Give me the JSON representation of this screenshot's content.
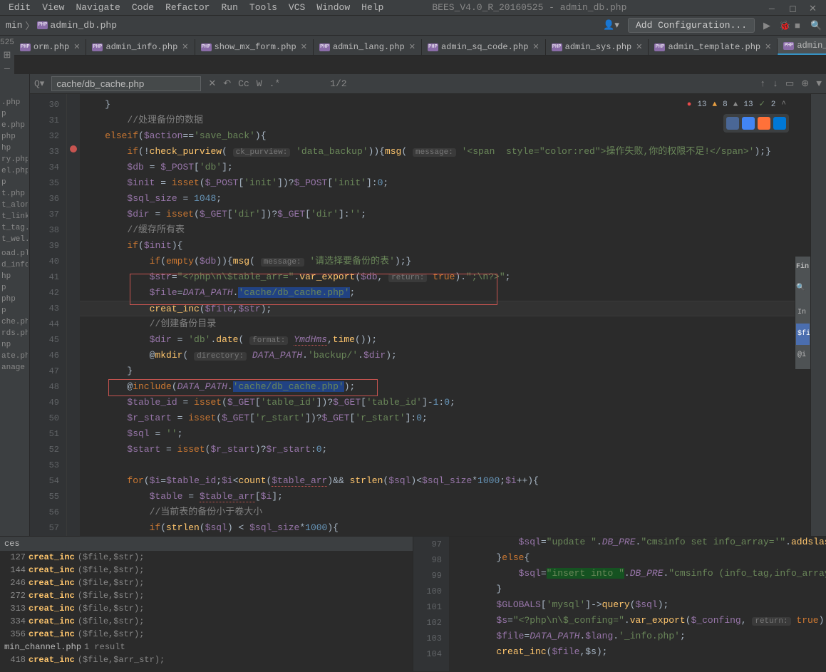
{
  "menu": {
    "edit": "Edit",
    "view": "View",
    "navigate": "Navigate",
    "code": "Code",
    "refactor": "Refactor",
    "run": "Run",
    "tools": "Tools",
    "vcs": "VCS",
    "window": "Window",
    "help": "Help"
  },
  "window_title": "BEES_V4.0_R_20160525 - admin_db.php",
  "breadcrumb": {
    "item1": "min",
    "item2": "admin_db.php"
  },
  "add_config_label": "Add Configuration...",
  "left_gutter": {
    "num": "525"
  },
  "tabs": [
    {
      "label": "orm.php"
    },
    {
      "label": "admin_info.php"
    },
    {
      "label": "show_mx_form.php"
    },
    {
      "label": "admin_lang.php"
    },
    {
      "label": "admin_sq_code.php"
    },
    {
      "label": "admin_sys.php"
    },
    {
      "label": "admin_template.php"
    },
    {
      "label": "admin_db.php",
      "active": true
    }
  ],
  "search": {
    "value": "cache/db_cache.php",
    "count": "1/2",
    "cc": "Cc",
    "w": "W"
  },
  "indicators": {
    "errors": "13",
    "warnings": "8",
    "weak": "13",
    "green": "2"
  },
  "left_tree": [
    ".php",
    "p",
    "e.php",
    "php",
    "hp",
    "ry.php",
    "el.php",
    "p",
    "t.php",
    "t_alone",
    "t_link.p",
    "t_tag.p",
    "t_wel.p",
    "",
    "oad.pl",
    "d_info.",
    "hp",
    "p",
    "php",
    "p",
    "che.ph",
    "rds.php",
    "np",
    "ate.php",
    "anage"
  ],
  "line_numbers": [
    "30",
    "31",
    "32",
    "33",
    "34",
    "35",
    "36",
    "37",
    "38",
    "39",
    "40",
    "41",
    "42",
    "43",
    "44",
    "45",
    "46",
    "47",
    "48",
    "49",
    "50",
    "51",
    "52",
    "53",
    "54",
    "55",
    "56",
    "57"
  ],
  "code": {
    "l30": "    }",
    "l31": "    //处理备份的数据",
    "l32_a": "elseif",
    "l32_b": "(",
    "l32_c": "$action",
    "l32_d": "==",
    "l32_e": "'save_back'",
    "l32_f": "){",
    "l33_a": "if",
    "l33_b": "(!",
    "l33_c": "check_purview",
    "l33_d": "(",
    "l33_hint1": "ck_purview:",
    "l33_e": "'data_backup'",
    "l33_f": ")){",
    "l33_g": "msg",
    "l33_h": "(",
    "l33_hint2": "message:",
    "l33_i": "'<span  style=\"color:red\">操作失败,你的权限不足!</span>'",
    "l33_j": ");}",
    "l34_a": "$db",
    "l34_b": " = ",
    "l34_c": "$_POST",
    "l34_d": "[",
    "l34_e": "'db'",
    "l34_f": "];",
    "l35_a": "$init",
    "l35_b": " = ",
    "l35_c": "isset",
    "l35_d": "(",
    "l35_e": "$_POST",
    "l35_f": "[",
    "l35_g": "'init'",
    "l35_h": "])?",
    "l35_i": "$_POST",
    "l35_j": "[",
    "l35_k": "'init'",
    "l35_l": "]:",
    "l35_m": "0",
    "l35_n": ";",
    "l36_a": "$sql_size",
    "l36_b": " = ",
    "l36_c": "1048",
    "l36_d": ";",
    "l37_a": "$dir",
    "l37_b": " = ",
    "l37_c": "isset",
    "l37_d": "(",
    "l37_e": "$_GET",
    "l37_f": "[",
    "l37_g": "'dir'",
    "l37_h": "])?",
    "l37_i": "$_GET",
    "l37_j": "[",
    "l37_k": "'dir'",
    "l37_l": "]:",
    "l37_m": "''",
    "l37_n": ";",
    "l38": "//缓存所有表",
    "l39_a": "if",
    "l39_b": "(",
    "l39_c": "$init",
    "l39_d": "){",
    "l40_a": "if",
    "l40_b": "(",
    "l40_c": "empty",
    "l40_d": "(",
    "l40_e": "$db",
    "l40_f": ")){",
    "l40_g": "msg",
    "l40_h": "(",
    "l40_hint": "message:",
    "l40_i": "'请选择要备份的表'",
    "l40_j": ");}",
    "l41_a": "$str",
    "l41_b": "=",
    "l41_c": "\"<?php\\n\\$table_arr=\"",
    "l41_d": ".",
    "l41_e": "var_export",
    "l41_f": "(",
    "l41_g": "$db",
    "l41_h": ",",
    "l41_hint": "return:",
    "l41_i": "true",
    "l41_j": ").",
    "l41_k": "\";\\n?>\"",
    "l41_l": ";",
    "l42_a": "$file",
    "l42_b": "=",
    "l42_c": "DATA_PATH",
    "l42_d": ".",
    "l42_e": "'cache/db_cache.php'",
    "l42_f": ";",
    "l43_a": " creat_inc",
    "l43_b": "(",
    "l43_c": "$file",
    "l43_d": ",",
    "l43_e": "$str",
    "l43_f": ");",
    "l44": "//创建备份目录",
    "l45_a": "$dir",
    "l45_b": " = ",
    "l45_c": "'db'",
    "l45_d": ".",
    "l45_e": "date",
    "l45_f": "(",
    "l45_hint": "format:",
    "l45_g": "YmdHms",
    "l45_h": ",",
    "l45_i": "time",
    "l45_j": "());",
    "l46_a": "@",
    "l46_b": "mkdir",
    "l46_c": "(",
    "l46_hint": "directory:",
    "l46_d": "DATA_PATH",
    "l46_e": ".",
    "l46_f": "'backup/'",
    "l46_g": ".",
    "l46_h": "$dir",
    "l46_i": ");",
    "l47": "}",
    "l48_a": "@",
    "l48_b": "include",
    "l48_c": "(",
    "l48_d": "DATA_PATH",
    "l48_e": ".",
    "l48_f": "'cache/db_cache.php'",
    "l48_g": ");",
    "l49_a": "$table_id",
    "l49_b": " = ",
    "l49_c": "isset",
    "l49_d": "(",
    "l49_e": "$_GET",
    "l49_f": "[",
    "l49_g": "'table_id'",
    "l49_h": "])?",
    "l49_i": "$_GET",
    "l49_j": "[",
    "l49_k": "'table_id'",
    "l49_l": "]-",
    "l49_m": "1",
    "l49_n": ":",
    "l49_o": "0",
    "l49_p": ";",
    "l50_a": "$r_start",
    "l50_b": " = ",
    "l50_c": "isset",
    "l50_d": "(",
    "l50_e": "$_GET",
    "l50_f": "[",
    "l50_g": "'r_start'",
    "l50_h": "])?",
    "l50_i": "$_GET",
    "l50_j": "[",
    "l50_k": "'r_start'",
    "l50_l": "]:",
    "l50_m": "0",
    "l50_n": ";",
    "l51_a": "$sql",
    "l51_b": " = ",
    "l51_c": "''",
    "l51_d": ";",
    "l52_a": "$start",
    "l52_b": " = ",
    "l52_c": "isset",
    "l52_d": "(",
    "l52_e": "$r_start",
    "l52_f": ")?",
    "l52_g": "$r_start",
    "l52_h": ":",
    "l52_i": "0",
    "l52_j": ";",
    "l53": "",
    "l54_a": "for",
    "l54_b": "(",
    "l54_c": "$i",
    "l54_d": "=",
    "l54_e": "$table_id",
    "l54_f": ";",
    "l54_g": "$i",
    "l54_h": "<",
    "l54_i": "count",
    "l54_j": "(",
    "l54_k": "$table_arr",
    "l54_l": ")&& ",
    "l54_m": "strlen",
    "l54_n": "(",
    "l54_o": "$sql",
    "l54_p": ")<",
    "l54_q": "$sql_size",
    "l54_r": "*",
    "l54_s": "1000",
    "l54_t": ";",
    "l54_u": "$i",
    "l54_v": "++){",
    "l55_a": "$table",
    "l55_b": " = ",
    "l55_c": "$table_arr",
    "l55_d": "[",
    "l55_e": "$i",
    "l55_f": "];",
    "l56": "//当前表的备份小于卷大小",
    "l57_a": "if",
    "l57_b": "(",
    "l57_c": "strlen",
    "l57_d": "(",
    "l57_e": "$sql",
    "l57_f": ") < ",
    "l57_g": "$sql_size",
    "l57_h": "*",
    "l57_i": "1000",
    "l57_j": "){"
  },
  "usages": {
    "header": "ces",
    "items": [
      {
        "num": "127",
        "func": "creat_inc",
        "args": "($file,$str);"
      },
      {
        "num": "144",
        "func": "creat_inc",
        "args": "($file,$str);"
      },
      {
        "num": "246",
        "func": "creat_inc",
        "args": "($file,$str);"
      },
      {
        "num": "272",
        "func": "creat_inc",
        "args": "($file,$str);"
      },
      {
        "num": "313",
        "func": "creat_inc",
        "args": "($file,$str);"
      },
      {
        "num": "334",
        "func": "creat_inc",
        "args": "($file,$str);"
      },
      {
        "num": "356",
        "func": "creat_inc",
        "args": "($file,$str);"
      }
    ],
    "file_result": "min_channel.php",
    "file_result_count": "1 result",
    "item_last": {
      "num": "418",
      "func": "creat_inc",
      "args": "($file,$arr_str);"
    }
  },
  "bottom_lines": [
    "97",
    "98",
    "99",
    "100",
    "101",
    "102",
    "103",
    "104"
  ],
  "bottom_code": {
    "l97_a": "$sql",
    "l97_b": "=",
    "l97_c": "\"update \"",
    "l97_d": ".",
    "l97_e": "DB_PRE",
    "l97_f": ".",
    "l97_g": "\"cmsinfo set info_array='\"",
    "l97_h": ".",
    "l97_i": "addslashes",
    "l97_j": "(va",
    "l98_a": "}",
    "l98_b": "else",
    "l98_c": "{",
    "l99_a": "$sql",
    "l99_b": "=",
    "l99_c": "\"insert into \"",
    "l99_d": ".",
    "l99_e": "DB_PRE",
    "l99_f": ".",
    "l99_g": "\"cmsinfo (info_tag,info_array,info_",
    "l100": "}",
    "l101_a": "$GLOBALS",
    "l101_b": "[",
    "l101_c": "'mysql'",
    "l101_d": "]->",
    "l101_e": "query",
    "l101_f": "(",
    "l101_g": "$sql",
    "l101_h": ");",
    "l102_a": "$s",
    "l102_b": "=",
    "l102_c": "\"<?php\\n\\$_confing=\"",
    "l102_d": ".",
    "l102_e": "var_export",
    "l102_f": "(",
    "l102_g": "$_confing",
    "l102_h": ",",
    "l102_hint": "return:",
    "l102_i": "true",
    "l102_j": ").",
    "l102_k": "\";\\n?>\"",
    "l102_l": ";",
    "l103_a": "$file",
    "l103_b": "=",
    "l103_c": "DATA_PATH",
    "l103_d": ".",
    "l103_e": "$lang",
    "l103_f": ".",
    "l103_g": "'_info.php'",
    "l103_h": ";",
    "l104_a": "creat_inc",
    "l104_b": "(",
    "l104_c": "$file",
    "l104_d": ",$s);"
  },
  "find_panel": {
    "title": "Fin",
    "rows": [
      "$fil",
      "@i"
    ]
  }
}
